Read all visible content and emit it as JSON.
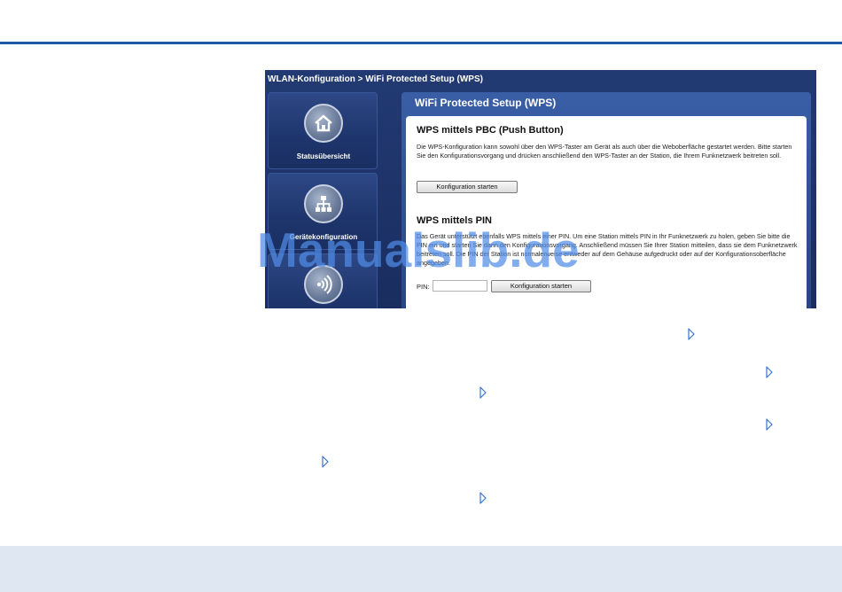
{
  "breadcrumb": "WLAN-Konfiguration  >  WiFi Protected Setup (WPS)",
  "nav": {
    "items": [
      {
        "label": "Statusübersicht",
        "icon": "home-icon"
      },
      {
        "label": "Gerätekonfiguration",
        "icon": "network-icon"
      },
      {
        "label": "",
        "icon": "wireless-icon"
      }
    ]
  },
  "panel": {
    "title": "WiFi Protected Setup (WPS)",
    "pbc": {
      "title": "WPS mittels PBC (Push Button)",
      "text": "Die WPS-Konfiguration kann sowohl über den WPS-Taster am Gerät als auch über die Weboberfläche gestartet werden. Bitte starten Sie den Konfigurationsvorgang und drücken anschließend den WPS-Taster an der Station, die Ihrem Funknetzwerk beitreten soll.",
      "button": "Konfiguration starten"
    },
    "pin": {
      "title": "WPS mittels PIN",
      "text": "Das Gerät unterstützt ebenfalls WPS mittels einer PIN. Um eine Station mittels PIN in Ihr Funknetzwerk zu holen, geben Sie bitte die PIN ein und starten Sie dann den Konfigurationsvorgang. Anschließend müssen Sie Ihrer Station mitteilen, dass sie dem Funknetzwerk beitreten soll. Die PIN der Station ist normalerweise entweder auf dem Gehäuse aufgedruckt oder auf der Konfigurationsoberfläche angegeben.",
      "pin_label": "PIN:",
      "pin_value": "",
      "button": "Konfiguration starten"
    }
  },
  "watermark": "Manualslib.de",
  "colors": {
    "rule": "#1f56a8",
    "footer": "#dfe7f3",
    "arrow": "#3b73c9"
  }
}
